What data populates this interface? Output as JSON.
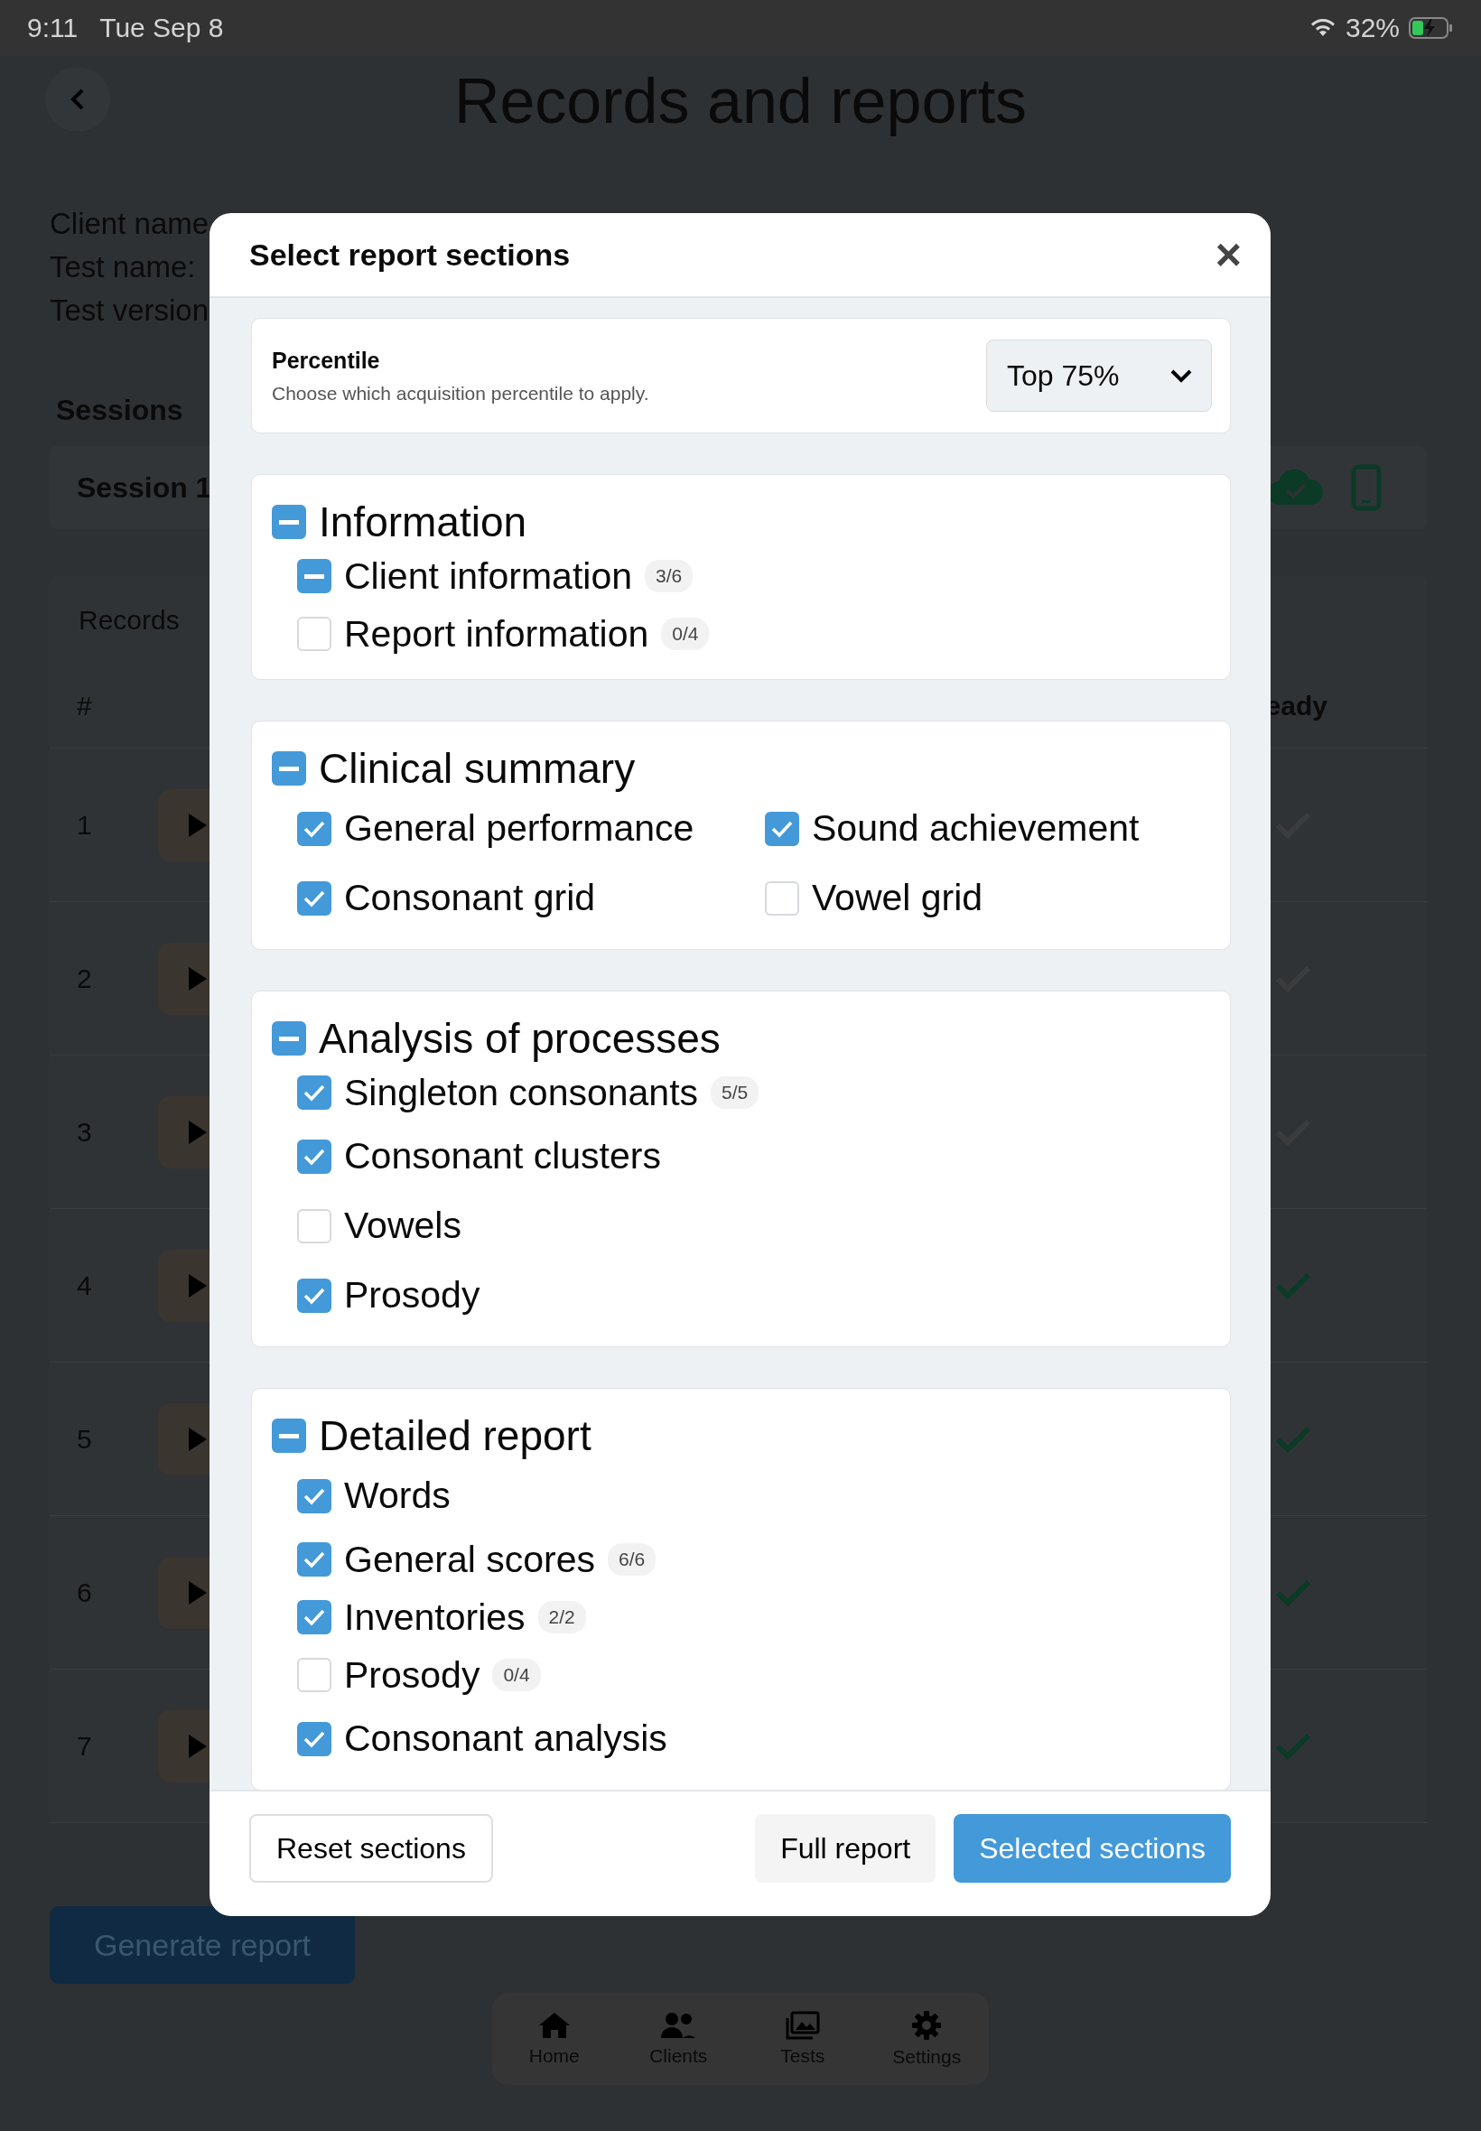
{
  "status_bar": {
    "time": "9:11",
    "date": "Tue Sep 8",
    "battery": "32%"
  },
  "header": {
    "title": "Records and reports"
  },
  "client_info": [
    "Client name",
    "Test name:",
    "Test version"
  ],
  "sessions": {
    "label": "Sessions",
    "session": "Session 1"
  },
  "records": {
    "tab": "Records",
    "column_1": "#",
    "column_last": "eady",
    "rows": [
      {
        "number": "1",
        "ready": false
      },
      {
        "number": "2",
        "ready": false
      },
      {
        "number": "3",
        "ready": false
      },
      {
        "number": "4",
        "ready": true
      },
      {
        "number": "5",
        "ready": true
      },
      {
        "number": "6",
        "ready": true
      },
      {
        "number": "7",
        "ready": true
      }
    ]
  },
  "generate_button": "Generate report",
  "nav": [
    {
      "label": "Home",
      "kind": "home"
    },
    {
      "label": "Clients",
      "kind": "clients"
    },
    {
      "label": "Tests",
      "kind": "tests"
    },
    {
      "label": "Settings",
      "kind": "settings"
    }
  ],
  "dialog": {
    "title": "Select report sections",
    "close": "×",
    "percentile": {
      "label": "Percentile",
      "description": "Choose which acquisition percentile to apply.",
      "value": "Top 75%"
    },
    "sections": [
      {
        "title": "Information",
        "checked": false,
        "indeterminate": true,
        "two_columns": false,
        "items": [
          {
            "label": "Client information",
            "checked": false,
            "indeterminate": true,
            "count": "3/6"
          },
          {
            "label": "Report information",
            "checked": false,
            "indeterminate": false,
            "count": "0/4"
          }
        ]
      },
      {
        "title": "Clinical summary",
        "checked": false,
        "indeterminate": true,
        "two_columns": true,
        "items": [
          {
            "label": "General performance",
            "checked": true,
            "indeterminate": false
          },
          {
            "label": "Sound achievement",
            "checked": true,
            "indeterminate": false
          },
          {
            "label": "Consonant grid",
            "checked": true,
            "indeterminate": false
          },
          {
            "label": "Vowel grid",
            "checked": false,
            "indeterminate": false
          }
        ]
      },
      {
        "title": "Analysis of processes",
        "checked": false,
        "indeterminate": true,
        "two_columns": false,
        "items": [
          {
            "label": "Singleton consonants",
            "checked": true,
            "indeterminate": false,
            "count": "5/5"
          },
          {
            "label": "Consonant clusters",
            "checked": true,
            "indeterminate": false
          },
          {
            "label": "Vowels",
            "checked": false,
            "indeterminate": false
          },
          {
            "label": "Prosody",
            "checked": true,
            "indeterminate": false
          }
        ]
      },
      {
        "title": "Detailed report",
        "checked": false,
        "indeterminate": true,
        "two_columns": false,
        "items": [
          {
            "label": "Words",
            "checked": true,
            "indeterminate": false
          },
          {
            "label": "General scores",
            "checked": true,
            "indeterminate": false,
            "count": "6/6"
          },
          {
            "label": "Inventories",
            "checked": true,
            "indeterminate": false,
            "count": "2/2"
          },
          {
            "label": "Prosody",
            "checked": false,
            "indeterminate": false,
            "count": "0/4"
          },
          {
            "label": "Consonant analysis",
            "checked": true,
            "indeterminate": false
          }
        ]
      }
    ],
    "buttons": [
      {
        "label": "Reset sections",
        "kind": "outline"
      },
      {
        "label": "Full report",
        "kind": "light"
      },
      {
        "label": "Selected sections",
        "kind": "primary"
      }
    ]
  }
}
